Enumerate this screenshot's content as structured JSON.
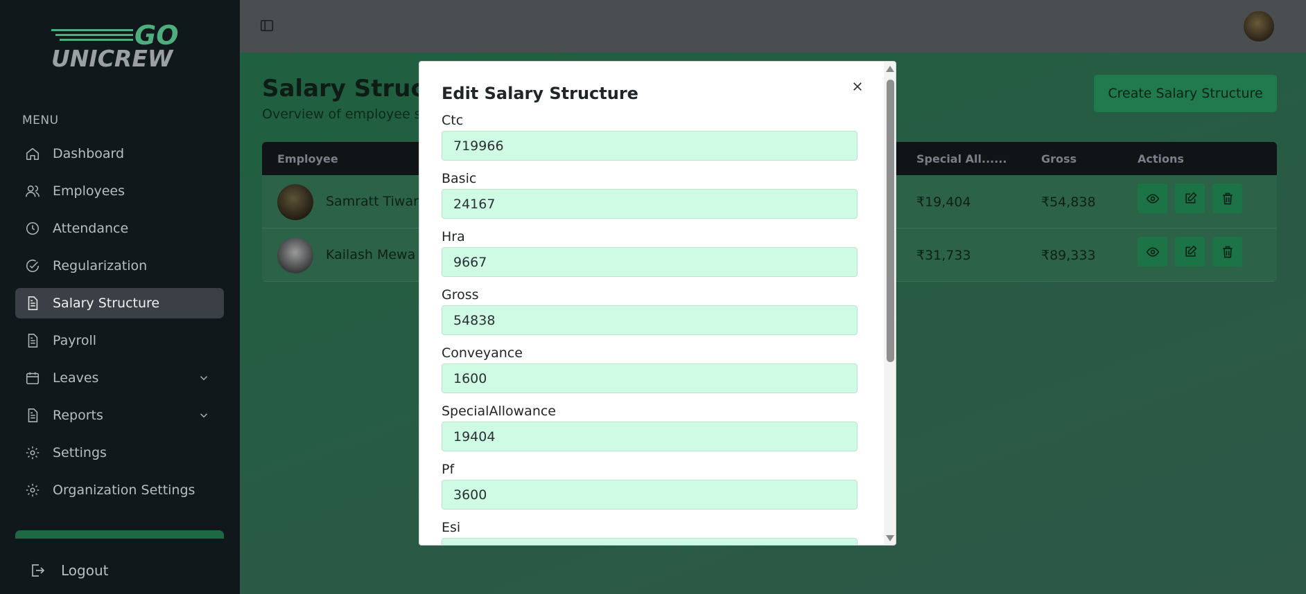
{
  "brand": {
    "line1": "GO",
    "line2": "UNICREW"
  },
  "sidebar": {
    "menu_label": "MENU",
    "items": [
      {
        "label": "Dashboard",
        "icon": "home-icon"
      },
      {
        "label": "Employees",
        "icon": "users-icon"
      },
      {
        "label": "Attendance",
        "icon": "clock-icon"
      },
      {
        "label": "Regularization",
        "icon": "check-circle-icon"
      },
      {
        "label": "Salary Structure",
        "icon": "document-icon",
        "active": true
      },
      {
        "label": "Payroll",
        "icon": "document-icon"
      },
      {
        "label": "Leaves",
        "icon": "calendar-icon",
        "expandable": true
      },
      {
        "label": "Reports",
        "icon": "document-icon",
        "expandable": true
      },
      {
        "label": "Settings",
        "icon": "gear-icon"
      },
      {
        "label": "Organization Settings",
        "icon": "gear-icon"
      }
    ],
    "logout_label": "Logout"
  },
  "page": {
    "title": "Salary Structu",
    "subtitle": "Overview of employee s",
    "create_button": "Create Salary Structure"
  },
  "table": {
    "headers": {
      "employee": "Employee",
      "special": "Special All......",
      "gross": "Gross",
      "actions": "Actions"
    },
    "rows": [
      {
        "name": "Samratt Tiwar",
        "special": "₹19,404",
        "gross": "₹54,838"
      },
      {
        "name": "Kailash Mewa",
        "special": "₹31,733",
        "gross": "₹89,333"
      }
    ]
  },
  "modal": {
    "title": "Edit Salary Structure",
    "fields": [
      {
        "label": "Ctc",
        "value": "719966"
      },
      {
        "label": "Basic",
        "value": "24167"
      },
      {
        "label": "Hra",
        "value": "9667"
      },
      {
        "label": "Gross",
        "value": "54838"
      },
      {
        "label": "Conveyance",
        "value": "1600"
      },
      {
        "label": "SpecialAllowance",
        "value": "19404"
      },
      {
        "label": "Pf",
        "value": "3600"
      },
      {
        "label": "Esi",
        "value": ""
      }
    ]
  },
  "colors": {
    "accent": "#1c7446",
    "input_bg": "#cffae3",
    "sidebar_bg": "#10181b"
  }
}
